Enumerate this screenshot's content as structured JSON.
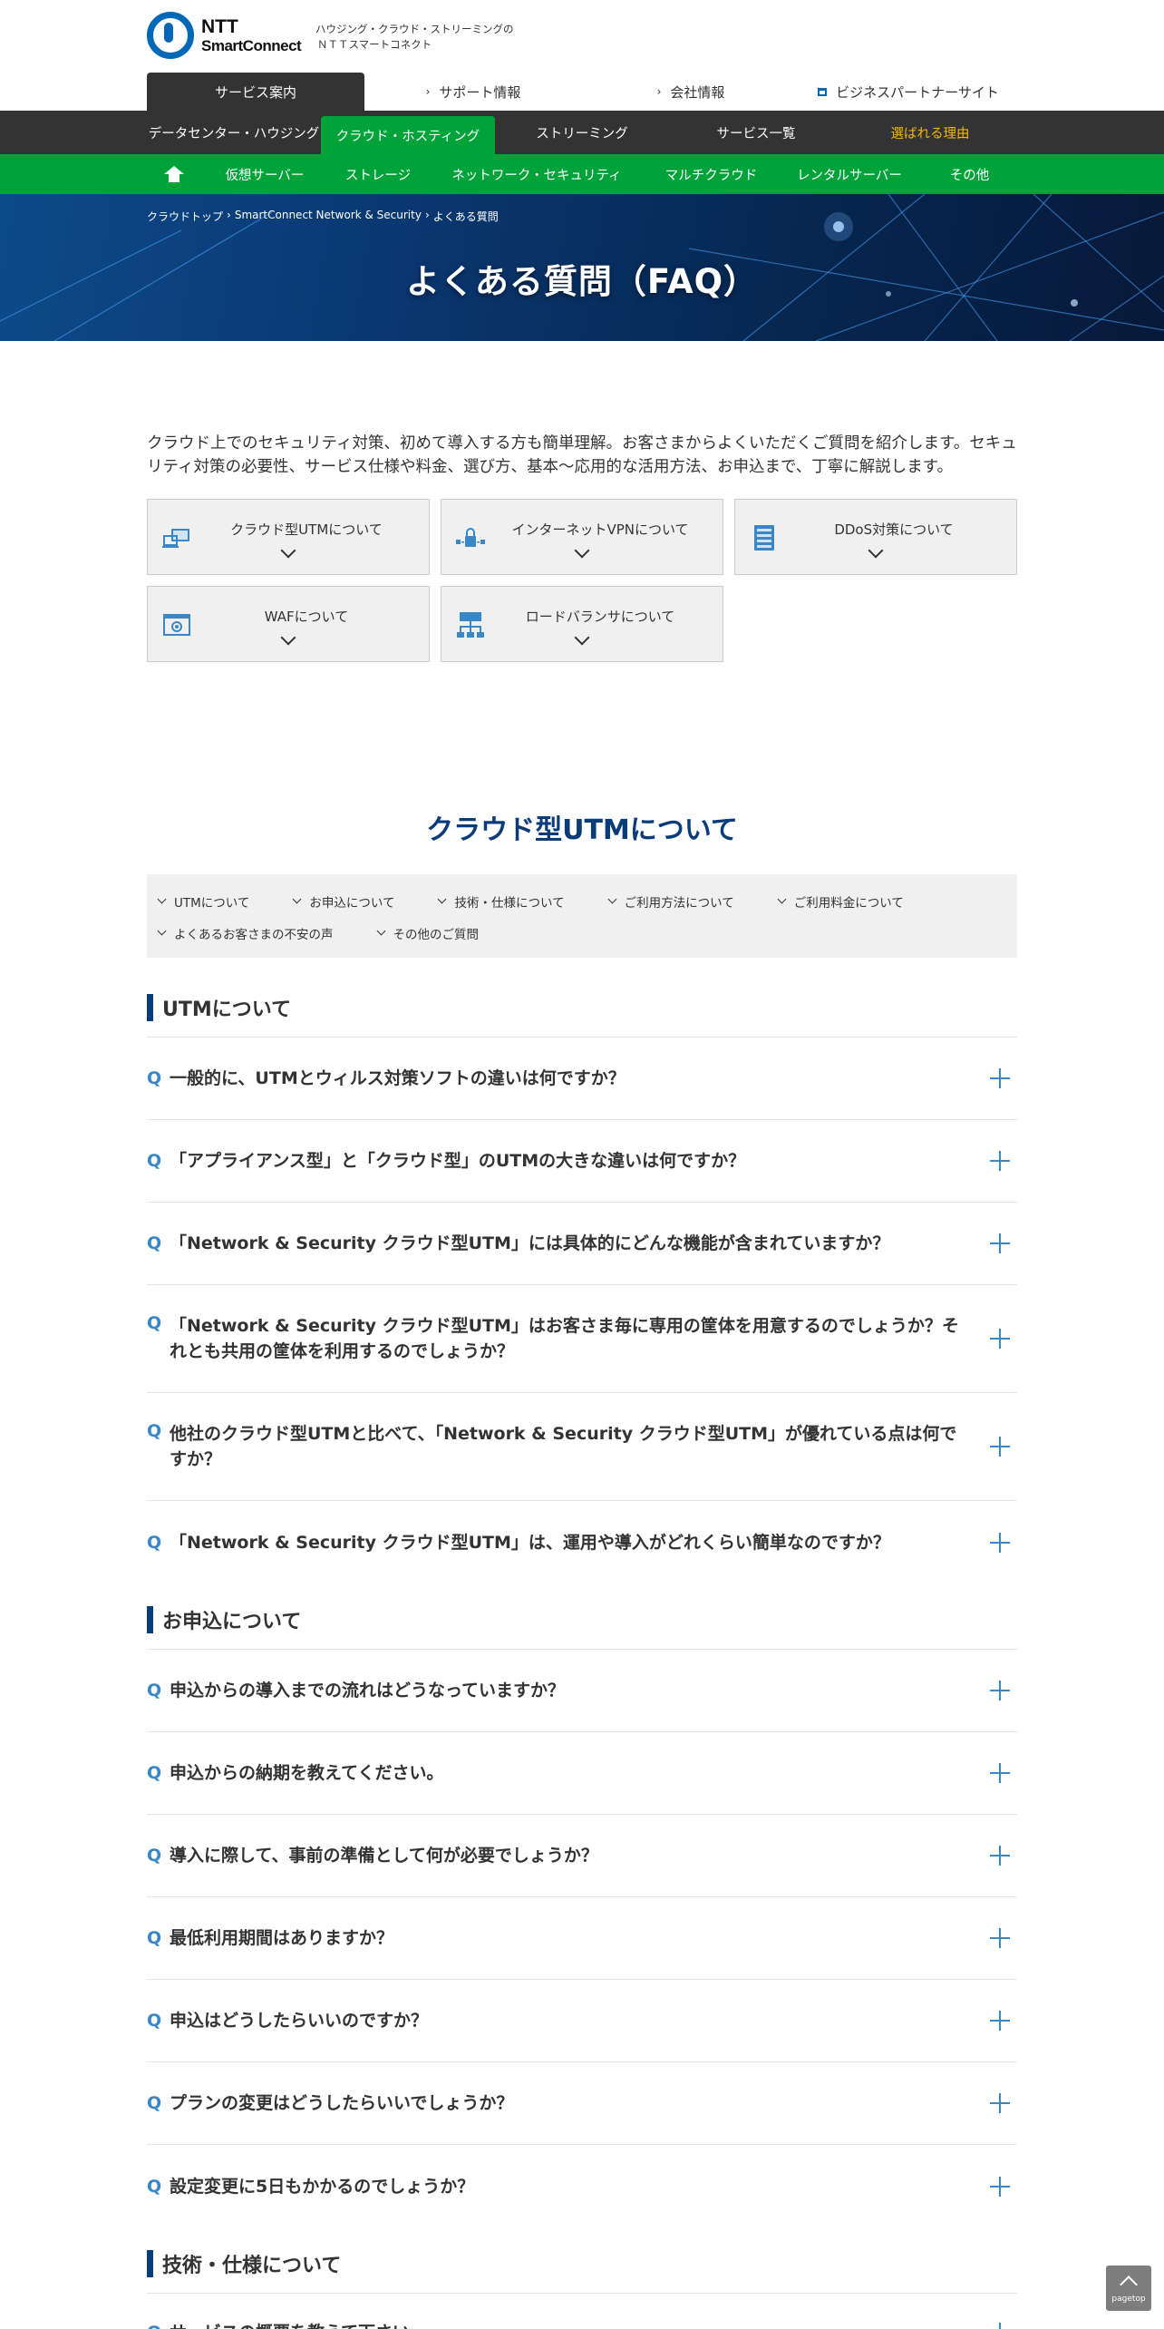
{
  "header": {
    "logo_ntt": "NTT",
    "logo_sc": "SmartConnect",
    "tagline_1": "ハウジング・クラウド・ストリーミングの",
    "tagline_2": "ＮＴＴスマートコネクト"
  },
  "util_nav": [
    {
      "label": "サービス案内"
    },
    {
      "label": "サポート情報"
    },
    {
      "label": "会社情報"
    },
    {
      "label": "ビジネスパートナーサイト"
    }
  ],
  "main_nav": [
    {
      "label": "データセンター・ハウジング"
    },
    {
      "label": "クラウド・ホスティング"
    },
    {
      "label": "ストリーミング"
    },
    {
      "label": "サービス一覧"
    },
    {
      "label": "選ばれる理由"
    }
  ],
  "sub_nav": [
    {
      "label": "仮想サーバー"
    },
    {
      "label": "ストレージ"
    },
    {
      "label": "ネットワーク・セキュリティ"
    },
    {
      "label": "マルチクラウド"
    },
    {
      "label": "レンタルサーバー"
    },
    {
      "label": "その他"
    }
  ],
  "breadcrumb": [
    "クラウドトップ",
    "›",
    "SmartConnect Network & Security",
    "›",
    "よくある質問"
  ],
  "hero_title": "よくある質問（FAQ）",
  "intro": "クラウド上でのセキュリティ対策、初めて導入する方も簡単理解。お客さまからよくいただくご質問を紹介します。セキュリティ対策の必要性、サービス仕様や料金、選び方、基本～応用的な活用方法、お申込まで、丁寧に解説します。",
  "cards": [
    {
      "label": "クラウド型UTMについて",
      "icon": "utm-icon"
    },
    {
      "label": "インターネットVPNについて",
      "icon": "vpn-icon"
    },
    {
      "label": "DDoS対策について",
      "icon": "ddos-icon"
    },
    {
      "label": "WAFについて",
      "icon": "waf-icon"
    },
    {
      "label": "ロードバランサについて",
      "icon": "load-balancer-icon"
    }
  ],
  "section_title": "クラウド型UTMについて",
  "anchors": [
    {
      "label": "UTMについて"
    },
    {
      "label": "お申込について"
    },
    {
      "label": "技術・仕様について"
    },
    {
      "label": "ご利用方法について"
    },
    {
      "label": "ご利用料金について"
    },
    {
      "label": "よくあるお客さまの不安の声"
    },
    {
      "label": "その他のご質問"
    }
  ],
  "categories": [
    {
      "title": "UTMについて",
      "questions": [
        {
          "q": "Q",
          "text": "一般的に、UTMとウィルス対策ソフトの違いは何ですか？"
        },
        {
          "q": "Q",
          "text": "「アプライアンス型」と「クラウド型」のUTMの大きな違いは何ですか？"
        },
        {
          "q": "Q",
          "text": "「Network & Security クラウド型UTM」には具体的にどんな機能が含まれていますか？"
        },
        {
          "q": "Q",
          "text": "「Network & Security クラウド型UTM」はお客さま毎に専用の筐体を用意するのでしょうか？それとも共用の筐体を利用するのでしょうか？"
        },
        {
          "q": "Q",
          "text": "他社のクラウド型UTMと比べて、「Network & Security クラウド型UTM」が優れている点は何ですか？"
        },
        {
          "q": "Q",
          "text": "「Network & Security クラウド型UTM」は、運用や導入がどれくらい簡単なのですか？"
        }
      ]
    },
    {
      "title": "お申込について",
      "questions": [
        {
          "q": "Q",
          "text": "申込からの導入までの流れはどうなっていますか？"
        },
        {
          "q": "Q",
          "text": "申込からの納期を教えてください。"
        },
        {
          "q": "Q",
          "text": "導入に際して、事前の準備として何が必要でしょうか？"
        },
        {
          "q": "Q",
          "text": "最低利用期間はありますか？"
        },
        {
          "q": "Q",
          "text": "申込はどうしたらいいのですか？"
        },
        {
          "q": "Q",
          "text": "プランの変更はどうしたらいいでしょうか？"
        },
        {
          "q": "Q",
          "text": "設定変更に5日もかかるのでしょうか？"
        }
      ]
    },
    {
      "title": "技術・仕様について",
      "questions": [
        {
          "q": "Q",
          "text": "サービスの概要を教えて下さい。"
        }
      ]
    }
  ],
  "pagetop": "pagetop"
}
